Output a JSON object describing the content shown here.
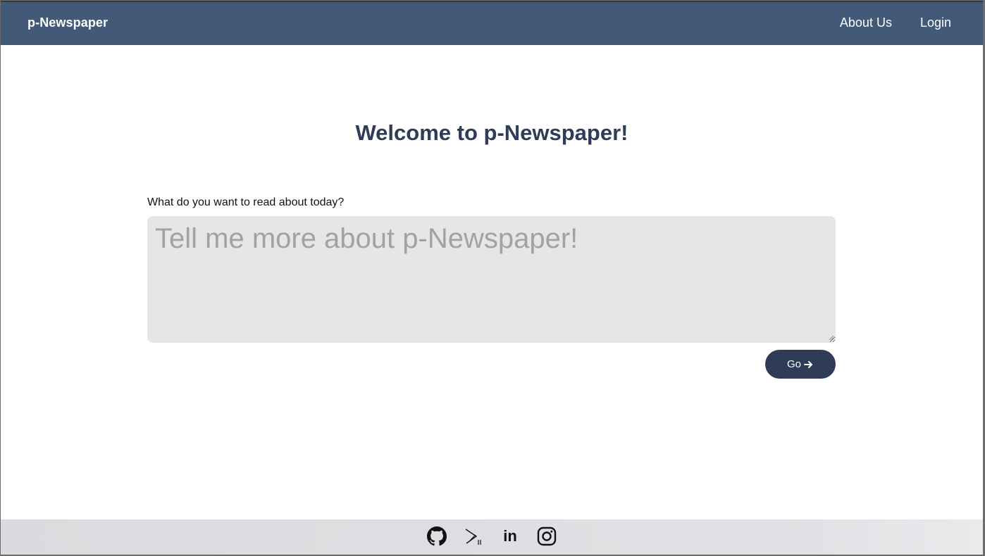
{
  "navbar": {
    "brand": "p-Newspaper",
    "links": [
      "About Us",
      "Login"
    ]
  },
  "main": {
    "heading": "Welcome to p-Newspaper!",
    "prompt_label": "What do you want to read about today?",
    "query_placeholder": "Tell me more about p-Newspaper!",
    "query_value": "",
    "go_label": "Go",
    "go_icon": "arrow-right-icon"
  },
  "footer": {
    "social_icons": [
      "github-icon",
      "substack-icon",
      "linkedin-icon",
      "instagram-icon"
    ],
    "linkedin_text": "in"
  },
  "colors": {
    "navbar": "#425977",
    "accent": "#2e3c58",
    "input_bg": "#e6e6e6",
    "footer_bg": "#dfe1e4"
  }
}
